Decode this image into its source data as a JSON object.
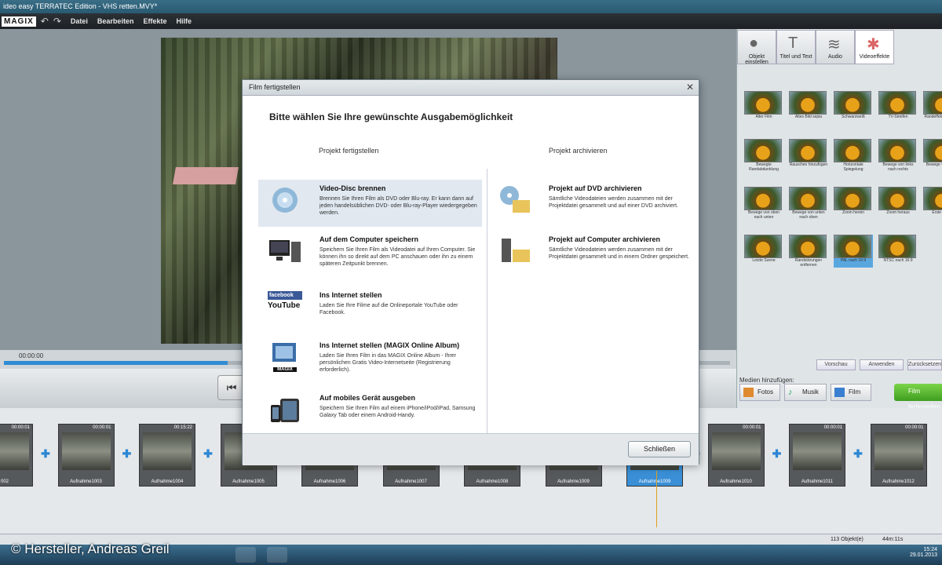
{
  "window": {
    "title": "ideo easy TERRATEC Edition - VHS retten.MVY*"
  },
  "menubar": {
    "logo": "MAGIX",
    "items": [
      "Datei",
      "Bearbeiten",
      "Effekte",
      "Hilfe"
    ]
  },
  "player": {
    "time": "00:00:00"
  },
  "right_panel": {
    "tabs": [
      "Objekt einstellen",
      "Titel und Text",
      "Audio",
      "Videoeffekte"
    ],
    "effects": [
      "Alter Film",
      "Altes Bild sepia",
      "Schwarzweiß",
      "TV-Streifen",
      "Randeffekt (Vignette)",
      "Bewegte Randabdunklung",
      "Rauschen hinzufügen",
      "Horizontale Spiegelung",
      "Bewege von links nach rechts",
      "Bewege von rechts",
      "Bewege von oben nach unten",
      "Bewege von unten nach oben",
      "Zoom herein",
      "Zoom heraus",
      "Erste Szene",
      "Letzte Szene",
      "Randstörungen entfernen",
      "PAL nach 16:9",
      "NTSC nach 16:9"
    ],
    "buttons": [
      "Vorschau",
      "Anwenden",
      "Zurücksetzen"
    ],
    "media_label": "Medien hinzufügen:",
    "media_buttons": [
      "Fotos",
      "Musik",
      "Film"
    ],
    "finish_button": "Film fertigstellen"
  },
  "timeline": {
    "clips": [
      {
        "name": "002",
        "dur": "00:00:01"
      },
      {
        "name": "Aufnahme1003",
        "dur": "00:00:01"
      },
      {
        "name": "Aufnahme1004",
        "dur": "00:15:22"
      },
      {
        "name": "Aufnahme1005",
        "dur": "00:00:01"
      },
      {
        "name": "Aufnahme1006",
        "dur": ""
      },
      {
        "name": "Aufnahme1007",
        "dur": ""
      },
      {
        "name": "Aufnahme1008",
        "dur": ""
      },
      {
        "name": "Aufnahme1009",
        "dur": ""
      },
      {
        "name": "Aufnahme1009",
        "dur": ""
      },
      {
        "name": "Aufnahme1010",
        "dur": "00:00:01"
      },
      {
        "name": "Aufnahme1011",
        "dur": "00:00:01"
      },
      {
        "name": "Aufnahme1012",
        "dur": "00:00:01"
      }
    ],
    "status_objects": "113 Objekt(e)",
    "status_time": "44m:11s"
  },
  "dialog": {
    "title": "Film fertigstellen",
    "heading": "Bitte wählen Sie Ihre gewünschte Ausgabemöglichkeit",
    "col1_header": "Projekt fertigstellen",
    "col2_header": "Projekt archivieren",
    "options_left": [
      {
        "title": "Video-Disc brennen",
        "desc": "Brennen Sie Ihren Film als DVD oder Blu-ray. Er kann dann auf jeden handelsüblichen DVD- oder Blu-ray-Player wiedergegeben werden."
      },
      {
        "title": "Auf dem Computer speichern",
        "desc": "Speichern Sie Ihren Film als Videodatei auf Ihren Computer. Sie können ihn so direkt auf dem PC anschauen oder ihn zu einem späteren Zeitpunkt brennen."
      },
      {
        "title": "Ins Internet stellen",
        "desc": "Laden Sie Ihre Filme auf die Onlineportale YouTube oder Facebook."
      },
      {
        "title": "Ins Internet stellen (MAGIX Online Album)",
        "desc": "Laden Sie Ihren Film in das MAGIX Online Album - Ihrer persönlichen Gratis Video-Internetseite (Registrierung erforderlich)."
      },
      {
        "title": "Auf mobiles Gerät ausgeben",
        "desc": "Speichern Sie Ihren Film auf einem iPhone/iPod/iPad, Samsung Galaxy Tab oder einem Android-Handy."
      }
    ],
    "options_right": [
      {
        "title": "Projekt auf DVD archivieren",
        "desc": "Sämtliche Videodateien werden zusammen mit der Projektdatei gesammelt und auf einer DVD archiviert."
      },
      {
        "title": "Projekt auf Computer archivieren",
        "desc": "Sämtliche Videodateien werden zusammen mit der Projektdatei gesammelt und in einem Ordner gespeichert."
      }
    ],
    "close_button": "Schließen",
    "icon_labels": {
      "facebook": "facebook",
      "youtube": "YouTube",
      "magix": "MAGIX"
    }
  },
  "taskbar": {
    "copyright": "© Hersteller, Andreas Greil",
    "clock_time": "15:24",
    "clock_date": "29.01.2013"
  }
}
